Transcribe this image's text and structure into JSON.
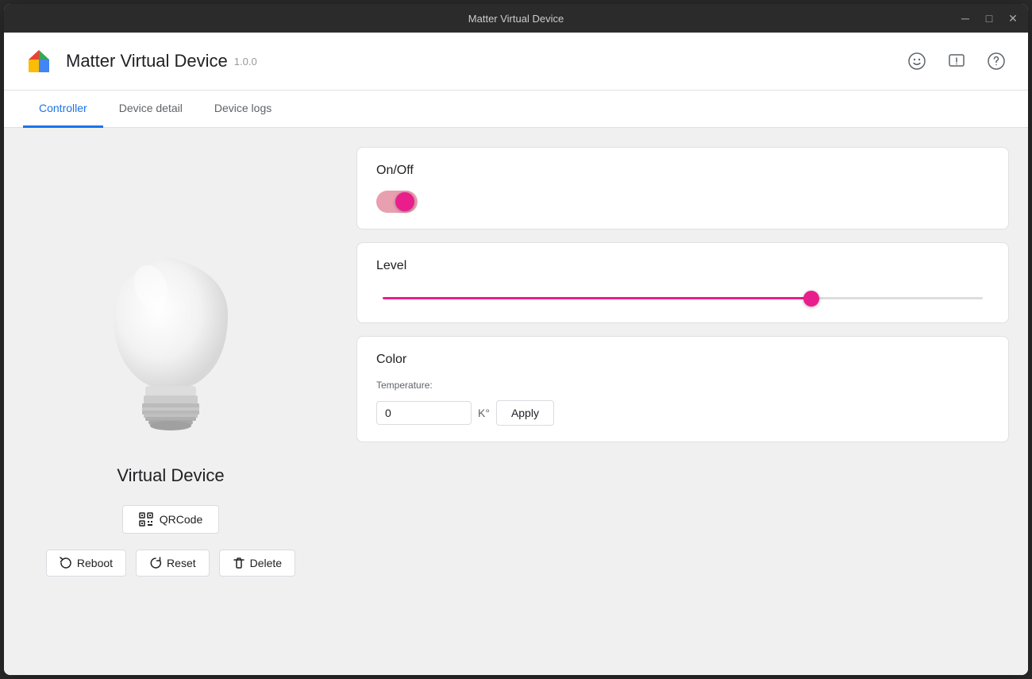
{
  "titleBar": {
    "title": "Matter Virtual Device",
    "minimizeIcon": "─",
    "maximizeIcon": "□",
    "closeIcon": "✕"
  },
  "header": {
    "appTitle": "Matter Virtual Device",
    "appVersion": "1.0.0",
    "icons": [
      {
        "name": "smiley-icon",
        "symbol": "☺"
      },
      {
        "name": "feedback-icon",
        "symbol": "⊡"
      },
      {
        "name": "help-icon",
        "symbol": "?"
      }
    ]
  },
  "tabs": [
    {
      "id": "controller",
      "label": "Controller",
      "active": true
    },
    {
      "id": "device-detail",
      "label": "Device detail",
      "active": false
    },
    {
      "id": "device-logs",
      "label": "Device logs",
      "active": false
    }
  ],
  "leftPanel": {
    "deviceName": "Virtual Device",
    "qrCodeLabel": "QRCode",
    "rebootLabel": "Reboot",
    "resetLabel": "Reset",
    "deleteLabel": "Delete"
  },
  "controls": {
    "onOff": {
      "label": "On/Off",
      "state": true
    },
    "level": {
      "label": "Level",
      "value": 72
    },
    "color": {
      "label": "Color",
      "temperatureLabel": "Temperature:",
      "temperatureValue": "0",
      "temperatureUnit": "K°",
      "applyLabel": "Apply"
    }
  }
}
